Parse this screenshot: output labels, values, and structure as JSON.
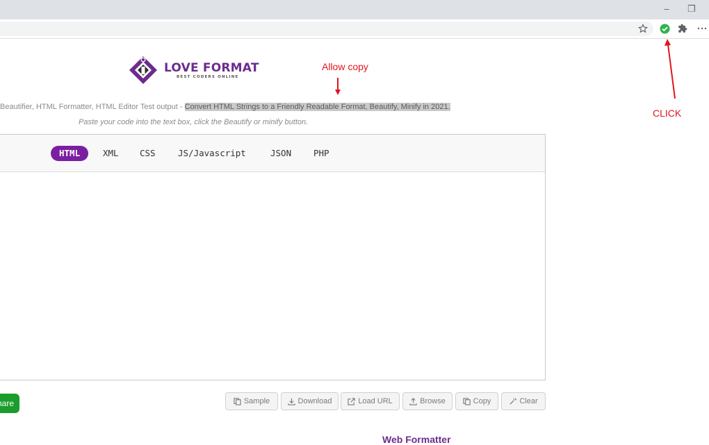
{
  "window": {
    "minimize": "–",
    "restore": "❐"
  },
  "toolbar": {
    "icons": [
      "star-icon",
      "extension-check-icon",
      "puzzle-icon",
      "menu-icon"
    ],
    "accent": "#2fb34a"
  },
  "logo": {
    "name": "LOVE FORMAT",
    "tagline": "BEST CODERS ONLINE",
    "color": "#6d2b8f"
  },
  "annotations": {
    "allow_copy": "Allow copy",
    "click": "CLICK",
    "color": "#e0141e"
  },
  "description": {
    "prefix": " Beautifier, HTML Formatter, HTML Editor Test output - ",
    "highlighted": "Convert HTML Strings to a Friendly Readable Format, Beautify, Minify in 2021."
  },
  "instructions": "Paste your code into the text box, click the Beautify or minify button.",
  "tabs": [
    {
      "label": "HTML",
      "active": true
    },
    {
      "label": "XML",
      "active": false
    },
    {
      "label": "CSS",
      "active": false
    },
    {
      "label": "JS/Javascript",
      "active": false
    },
    {
      "label": "JSON",
      "active": false
    },
    {
      "label": "PHP",
      "active": false
    }
  ],
  "tab_accent": "#7b1fa2",
  "share_button": "hare",
  "share_color": "#1a9d2a",
  "actions": {
    "sample": "Sample",
    "download": "Download",
    "load_url": "Load URL",
    "browse": "Browse",
    "copy": "Copy",
    "clear": "Clear"
  },
  "bottom_title": "Web Formatter"
}
